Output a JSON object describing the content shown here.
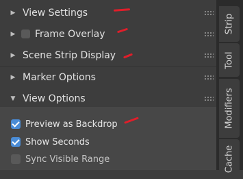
{
  "panel": {
    "headers": [
      {
        "label": "View Settings",
        "state": "collapsed",
        "has_checkbox": false
      },
      {
        "label": "Frame Overlay",
        "state": "collapsed",
        "has_checkbox": true,
        "checked": false
      },
      {
        "label": "Scene Strip Display",
        "state": "collapsed",
        "has_checkbox": false
      },
      {
        "label": "Marker Options",
        "state": "collapsed",
        "has_checkbox": false
      },
      {
        "label": "View Options",
        "state": "expanded",
        "has_checkbox": false
      }
    ],
    "view_options": [
      {
        "label": "Preview as Backdrop",
        "checked": true
      },
      {
        "label": "Show Seconds",
        "checked": true
      },
      {
        "label": "Sync Visible Range",
        "checked": false
      }
    ]
  },
  "tabs": [
    "Strip",
    "Tool",
    "Modifiers",
    "Cache"
  ],
  "icons": {
    "collapsed": "▶",
    "expanded": "▼"
  },
  "colors": {
    "background": "#3d3d3d",
    "checkbox_on": "#4a8cd6",
    "annotation": "#e01e2a"
  }
}
